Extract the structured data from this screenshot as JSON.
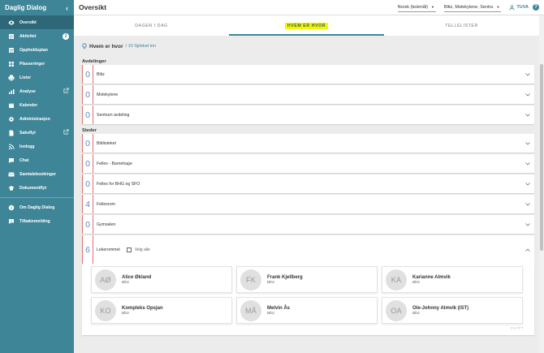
{
  "sidebar": {
    "title": "Daglig Dialog",
    "items": [
      {
        "label": "Oversikt",
        "icon": "eye-icon",
        "active": true
      },
      {
        "label": "Aktivitet",
        "icon": "activity-icon",
        "badge": "2"
      },
      {
        "label": "Oppholdsplan",
        "icon": "calendar-grid-icon"
      },
      {
        "label": "Plasseringer",
        "icon": "grid-icon"
      },
      {
        "label": "Lister",
        "icon": "print-icon"
      },
      {
        "label": "Analyse",
        "icon": "chart-icon",
        "external": true
      },
      {
        "label": "Kalender",
        "icon": "calendar-icon"
      },
      {
        "label": "Administrasjon",
        "icon": "gear-icon"
      },
      {
        "label": "Saksflyt",
        "icon": "document-icon",
        "external": true
      },
      {
        "label": "Innlegg",
        "icon": "rss-icon"
      },
      {
        "label": "Chat",
        "icon": "chat-icon"
      },
      {
        "label": "Samtalebookinger",
        "icon": "booking-icon"
      },
      {
        "label": "Dokumentflyt",
        "icon": "school-icon"
      }
    ],
    "secondary_items": [
      {
        "label": "Om Daglig Dialog",
        "icon": "info-icon"
      },
      {
        "label": "Tilbakemelding",
        "icon": "feedback-icon"
      }
    ]
  },
  "topbar": {
    "title": "Oversikt",
    "language": "Norsk (bokmål)",
    "location": "Blitz, Molekylene, Sentru",
    "user": "TUVA",
    "help": "?"
  },
  "tabs": [
    {
      "label": "DAGEN I DAG",
      "active": false
    },
    {
      "label": "HVEM ER HVOR",
      "active": true
    },
    {
      "label": "TELLELISTER",
      "active": false
    }
  ],
  "main": {
    "heading": "Hvem er hvor",
    "subheading": "/ 10 Sjekket inn",
    "section_departments": "Avdelinger",
    "departments": [
      {
        "count": "0",
        "name": "Blitz"
      },
      {
        "count": "0",
        "name": "Molekylene"
      },
      {
        "count": "0",
        "name": "Sentrum avdeling"
      }
    ],
    "section_places": "Steder",
    "places": [
      {
        "count": "0",
        "name": "Biblioteket"
      },
      {
        "count": "0",
        "name": "Felles - Barnehage"
      },
      {
        "count": "0",
        "name": "Felles for BHG og SFO"
      },
      {
        "count": "4",
        "name": "Fellesrom"
      },
      {
        "count": "0",
        "name": "Gymsalen"
      }
    ],
    "expanded": {
      "count": "6",
      "name": "Lekerommet",
      "select_all": "Velg alle",
      "children": [
        {
          "initials": "AØ",
          "name": "Alice Økland",
          "group": "Blitz"
        },
        {
          "initials": "FK",
          "name": "Frank Kjellberg",
          "group": "Blitz"
        },
        {
          "initials": "KA",
          "name": "Karianne Almvik",
          "group": "Blitz"
        },
        {
          "initials": "KO",
          "name": "Kompleks Opsjan",
          "group": "Blitz"
        },
        {
          "initials": "MÅ",
          "name": "Melvin Ås",
          "group": "Blitz"
        },
        {
          "initials": "OA",
          "name": "Ole-Johnny Almvik (IST)",
          "group": "Blitz"
        }
      ],
      "move_label": "FLYTT"
    }
  }
}
